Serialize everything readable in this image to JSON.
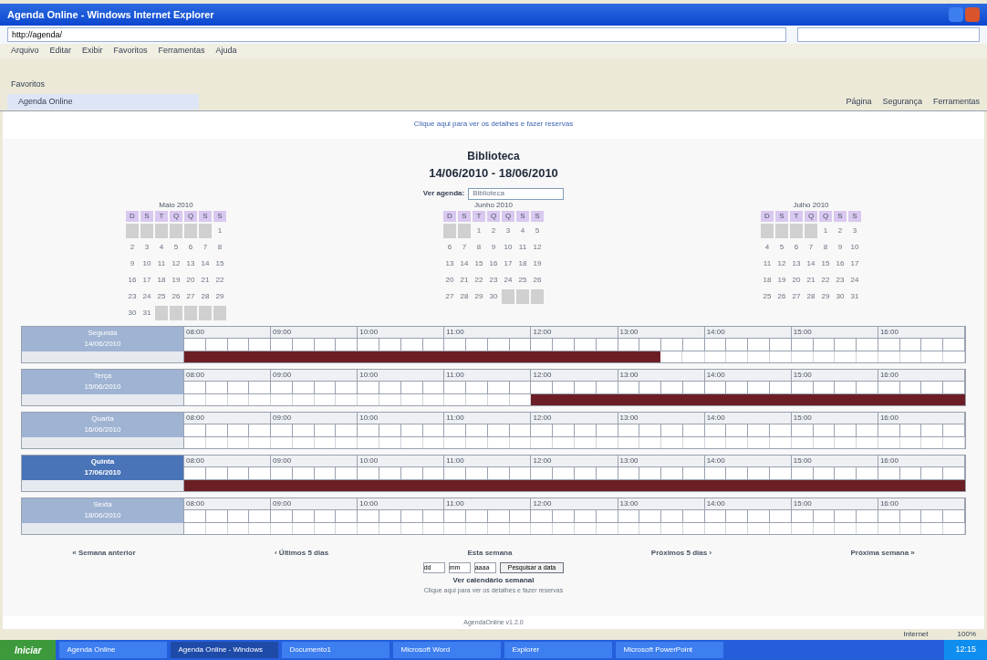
{
  "window": {
    "title": "Agenda Online - Windows Internet Explorer"
  },
  "address_bar": {
    "value": "http://agenda/"
  },
  "menu": [
    "Arquivo",
    "Editar",
    "Exibir",
    "Favoritos",
    "Ferramentas",
    "Ajuda"
  ],
  "favorites_bar": {
    "label": "Favoritos"
  },
  "tab": {
    "label": "Agenda Online"
  },
  "command_bar": [
    "Página",
    "Segurança",
    "Ferramentas"
  ],
  "page": {
    "top_link": "Clique aqui para ver os detalhes e fazer reservas",
    "title": "Biblioteca",
    "range": "14/06/2010 - 18/06/2010",
    "agenda_label": "Ver agenda:",
    "agenda_value": "Biblioteca",
    "months": [
      {
        "title": "Maio 2010",
        "weekday_headers": [
          "D",
          "S",
          "T",
          "Q",
          "Q",
          "S",
          "S"
        ],
        "cells": [
          {
            "kind": "blank"
          },
          {
            "kind": "blank"
          },
          {
            "kind": "blank"
          },
          {
            "kind": "blank"
          },
          {
            "kind": "blank"
          },
          {
            "kind": "blank"
          },
          {
            "kind": "day",
            "label": "1"
          },
          {
            "kind": "day",
            "label": "2"
          },
          {
            "kind": "day",
            "label": "3"
          },
          {
            "kind": "day",
            "label": "4"
          },
          {
            "kind": "day",
            "label": "5"
          },
          {
            "kind": "day",
            "label": "6"
          },
          {
            "kind": "day",
            "label": "7"
          },
          {
            "kind": "day",
            "label": "8"
          },
          {
            "kind": "day",
            "label": "9"
          },
          {
            "kind": "day",
            "label": "10"
          },
          {
            "kind": "day",
            "label": "11"
          },
          {
            "kind": "day",
            "label": "12"
          },
          {
            "kind": "day",
            "label": "13"
          },
          {
            "kind": "day",
            "label": "14"
          },
          {
            "kind": "day",
            "label": "15"
          },
          {
            "kind": "day",
            "label": "16"
          },
          {
            "kind": "day",
            "label": "17"
          },
          {
            "kind": "day",
            "label": "18"
          },
          {
            "kind": "day",
            "label": "19"
          },
          {
            "kind": "day",
            "label": "20"
          },
          {
            "kind": "day",
            "label": "21"
          },
          {
            "kind": "day",
            "label": "22"
          },
          {
            "kind": "day",
            "label": "23"
          },
          {
            "kind": "day",
            "label": "24"
          },
          {
            "kind": "day",
            "label": "25"
          },
          {
            "kind": "day",
            "label": "26"
          },
          {
            "kind": "day",
            "label": "27"
          },
          {
            "kind": "day",
            "label": "28"
          },
          {
            "kind": "day",
            "label": "29"
          },
          {
            "kind": "day",
            "label": "30"
          },
          {
            "kind": "day",
            "label": "31"
          },
          {
            "kind": "blank"
          },
          {
            "kind": "blank"
          },
          {
            "kind": "blank"
          },
          {
            "kind": "blank"
          },
          {
            "kind": "blank"
          }
        ]
      },
      {
        "title": "Junho 2010",
        "weekday_headers": [
          "D",
          "S",
          "T",
          "Q",
          "Q",
          "S",
          "S"
        ],
        "cells": [
          {
            "kind": "blank"
          },
          {
            "kind": "blank"
          },
          {
            "kind": "day",
            "label": "1"
          },
          {
            "kind": "day",
            "label": "2"
          },
          {
            "kind": "day",
            "label": "3"
          },
          {
            "kind": "day",
            "label": "4"
          },
          {
            "kind": "day",
            "label": "5"
          },
          {
            "kind": "day",
            "label": "6"
          },
          {
            "kind": "day",
            "label": "7"
          },
          {
            "kind": "day",
            "label": "8"
          },
          {
            "kind": "day",
            "label": "9"
          },
          {
            "kind": "day",
            "label": "10"
          },
          {
            "kind": "day",
            "label": "11"
          },
          {
            "kind": "day",
            "label": "12"
          },
          {
            "kind": "day",
            "label": "13"
          },
          {
            "kind": "day",
            "label": "14"
          },
          {
            "kind": "day",
            "label": "15"
          },
          {
            "kind": "day",
            "label": "16"
          },
          {
            "kind": "day",
            "label": "17"
          },
          {
            "kind": "day",
            "label": "18"
          },
          {
            "kind": "day",
            "label": "19"
          },
          {
            "kind": "day",
            "label": "20"
          },
          {
            "kind": "day",
            "label": "21"
          },
          {
            "kind": "day",
            "label": "22"
          },
          {
            "kind": "day",
            "label": "23"
          },
          {
            "kind": "day",
            "label": "24"
          },
          {
            "kind": "day",
            "label": "25"
          },
          {
            "kind": "day",
            "label": "26"
          },
          {
            "kind": "day",
            "label": "27"
          },
          {
            "kind": "day",
            "label": "28"
          },
          {
            "kind": "day",
            "label": "29"
          },
          {
            "kind": "day",
            "label": "30"
          },
          {
            "kind": "blank"
          },
          {
            "kind": "blank"
          },
          {
            "kind": "blank"
          }
        ]
      },
      {
        "title": "Julho 2010",
        "weekday_headers": [
          "D",
          "S",
          "T",
          "Q",
          "Q",
          "S",
          "S"
        ],
        "cells": [
          {
            "kind": "blank"
          },
          {
            "kind": "blank"
          },
          {
            "kind": "blank"
          },
          {
            "kind": "blank"
          },
          {
            "kind": "day",
            "label": "1"
          },
          {
            "kind": "day",
            "label": "2"
          },
          {
            "kind": "day",
            "label": "3"
          },
          {
            "kind": "day",
            "label": "4"
          },
          {
            "kind": "day",
            "label": "5"
          },
          {
            "kind": "day",
            "label": "6"
          },
          {
            "kind": "day",
            "label": "7"
          },
          {
            "kind": "day",
            "label": "8"
          },
          {
            "kind": "day",
            "label": "9"
          },
          {
            "kind": "day",
            "label": "10"
          },
          {
            "kind": "day",
            "label": "11"
          },
          {
            "kind": "day",
            "label": "12"
          },
          {
            "kind": "day",
            "label": "13"
          },
          {
            "kind": "day",
            "label": "14"
          },
          {
            "kind": "day",
            "label": "15"
          },
          {
            "kind": "day",
            "label": "16"
          },
          {
            "kind": "day",
            "label": "17"
          },
          {
            "kind": "day",
            "label": "18"
          },
          {
            "kind": "day",
            "label": "19"
          },
          {
            "kind": "day",
            "label": "20"
          },
          {
            "kind": "day",
            "label": "21"
          },
          {
            "kind": "day",
            "label": "22"
          },
          {
            "kind": "day",
            "label": "23"
          },
          {
            "kind": "day",
            "label": "24"
          },
          {
            "kind": "day",
            "label": "25"
          },
          {
            "kind": "day",
            "label": "26"
          },
          {
            "kind": "day",
            "label": "27"
          },
          {
            "kind": "day",
            "label": "28"
          },
          {
            "kind": "day",
            "label": "29"
          },
          {
            "kind": "day",
            "label": "30"
          },
          {
            "kind": "day",
            "label": "31"
          }
        ]
      }
    ],
    "days": [
      {
        "name": "Segunda",
        "date": "14/06/2010",
        "selected": false,
        "hours": [
          {
            "label": "08:00",
            "booked": [
              true,
              true,
              true,
              true
            ]
          },
          {
            "label": "09:00",
            "booked": [
              true,
              true,
              true,
              true
            ]
          },
          {
            "label": "10:00",
            "booked": [
              true,
              true,
              true,
              true
            ]
          },
          {
            "label": "11:00",
            "booked": [
              true,
              true,
              true,
              true
            ]
          },
          {
            "label": "12:00",
            "booked": [
              true,
              true,
              true,
              true
            ]
          },
          {
            "label": "13:00",
            "booked": [
              true,
              true,
              false,
              false
            ]
          },
          {
            "label": "14:00",
            "booked": [
              false,
              false,
              false,
              false
            ]
          },
          {
            "label": "15:00",
            "booked": [
              false,
              false,
              false,
              false
            ]
          },
          {
            "label": "16:00",
            "booked": [
              false,
              false,
              false,
              false
            ]
          }
        ]
      },
      {
        "name": "Terça",
        "date": "15/06/2010",
        "selected": false,
        "hours": [
          {
            "label": "08:00",
            "booked": [
              false,
              false,
              false,
              false
            ]
          },
          {
            "label": "09:00",
            "booked": [
              false,
              false,
              false,
              false
            ]
          },
          {
            "label": "10:00",
            "booked": [
              false,
              false,
              false,
              false
            ]
          },
          {
            "label": "11:00",
            "booked": [
              false,
              false,
              false,
              false
            ]
          },
          {
            "label": "12:00",
            "booked": [
              true,
              true,
              true,
              true
            ]
          },
          {
            "label": "13:00",
            "booked": [
              true,
              true,
              true,
              true
            ]
          },
          {
            "label": "14:00",
            "booked": [
              true,
              true,
              true,
              true
            ]
          },
          {
            "label": "15:00",
            "booked": [
              true,
              true,
              true,
              true
            ]
          },
          {
            "label": "16:00",
            "booked": [
              true,
              true,
              true,
              true
            ]
          }
        ]
      },
      {
        "name": "Quarta",
        "date": "16/06/2010",
        "selected": false,
        "hours": [
          {
            "label": "08:00",
            "booked": [
              false,
              false,
              false,
              false
            ]
          },
          {
            "label": "09:00",
            "booked": [
              false,
              false,
              false,
              false
            ]
          },
          {
            "label": "10:00",
            "booked": [
              false,
              false,
              false,
              false
            ]
          },
          {
            "label": "11:00",
            "booked": [
              false,
              false,
              false,
              false
            ]
          },
          {
            "label": "12:00",
            "booked": [
              false,
              false,
              false,
              false
            ]
          },
          {
            "label": "13:00",
            "booked": [
              false,
              false,
              false,
              false
            ]
          },
          {
            "label": "14:00",
            "booked": [
              false,
              false,
              false,
              false
            ]
          },
          {
            "label": "15:00",
            "booked": [
              false,
              false,
              false,
              false
            ]
          },
          {
            "label": "16:00",
            "booked": [
              false,
              false,
              false,
              false
            ]
          }
        ]
      },
      {
        "name": "Quinta",
        "date": "17/06/2010",
        "selected": true,
        "hours": [
          {
            "label": "08:00",
            "booked": [
              true,
              true,
              true,
              true
            ]
          },
          {
            "label": "09:00",
            "booked": [
              true,
              true,
              true,
              true
            ]
          },
          {
            "label": "10:00",
            "booked": [
              true,
              true,
              true,
              true
            ]
          },
          {
            "label": "11:00",
            "booked": [
              true,
              true,
              true,
              true
            ]
          },
          {
            "label": "12:00",
            "booked": [
              true,
              true,
              true,
              true
            ]
          },
          {
            "label": "13:00",
            "booked": [
              true,
              true,
              true,
              true
            ]
          },
          {
            "label": "14:00",
            "booked": [
              true,
              true,
              true,
              true
            ]
          },
          {
            "label": "15:00",
            "booked": [
              true,
              true,
              true,
              true
            ]
          },
          {
            "label": "16:00",
            "booked": [
              true,
              true,
              true,
              true
            ]
          }
        ]
      },
      {
        "name": "Sexta",
        "date": "18/06/2010",
        "selected": false,
        "hours": [
          {
            "label": "08:00",
            "booked": [
              false,
              false,
              false,
              false
            ]
          },
          {
            "label": "09:00",
            "booked": [
              false,
              false,
              false,
              false
            ]
          },
          {
            "label": "10:00",
            "booked": [
              false,
              false,
              false,
              false
            ]
          },
          {
            "label": "11:00",
            "booked": [
              false,
              false,
              false,
              false
            ]
          },
          {
            "label": "12:00",
            "booked": [
              false,
              false,
              false,
              false
            ]
          },
          {
            "label": "13:00",
            "booked": [
              false,
              false,
              false,
              false
            ]
          },
          {
            "label": "14:00",
            "booked": [
              false,
              false,
              false,
              false
            ]
          },
          {
            "label": "15:00",
            "booked": [
              false,
              false,
              false,
              false
            ]
          },
          {
            "label": "16:00",
            "booked": [
              false,
              false,
              false,
              false
            ]
          }
        ]
      }
    ],
    "nav": [
      "« Semana anterior",
      "‹ Últimos 5 dias",
      "Esta semana",
      "Próximos 5 dias ›",
      "Próxima semana »"
    ],
    "date_fields": [
      {
        "value": "dd"
      },
      {
        "value": "mm"
      },
      {
        "value": "aaaa"
      }
    ],
    "go_button": "Pesquisar a data",
    "weekly_link": "Ver calendário semanal",
    "bottom_link": "Clique aqui para ver os detalhes e fazer reservas",
    "footer": "AgendaOnline v1.2.0"
  },
  "status_bar": {
    "zone": "Internet",
    "zoom": "100%"
  },
  "taskbar": {
    "start": "Iniciar",
    "items": [
      {
        "label": "Agenda Online",
        "selected": false
      },
      {
        "label": "Agenda Online - Windows",
        "selected": true
      },
      {
        "label": "Documento1",
        "selected": false
      },
      {
        "label": "Microsoft Word",
        "selected": false
      },
      {
        "label": "Explorer",
        "selected": false
      },
      {
        "label": "Microsoft PowerPoint",
        "selected": false
      }
    ],
    "clock": "12:15"
  }
}
